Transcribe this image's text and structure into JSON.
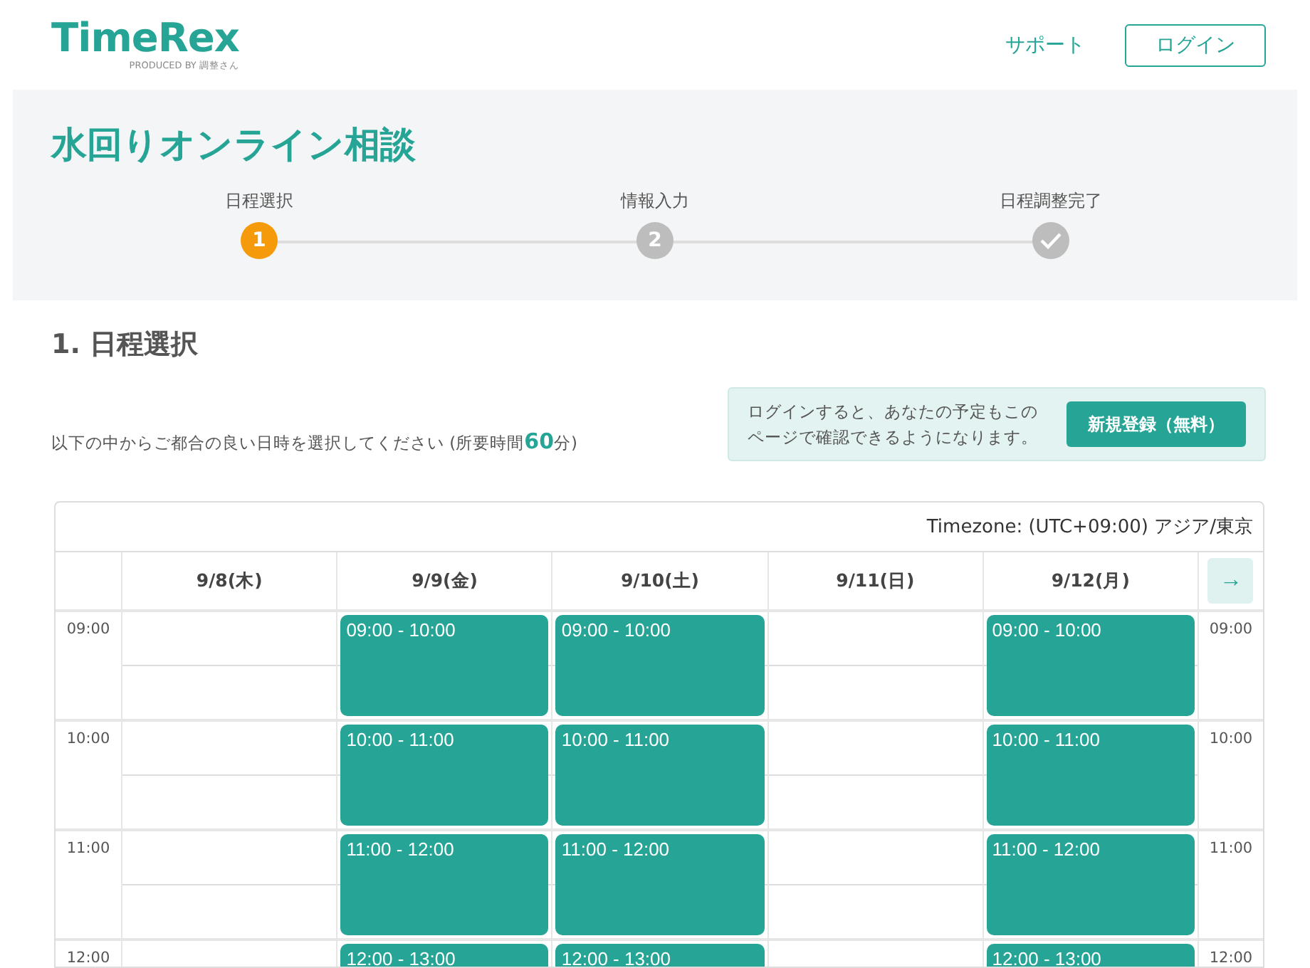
{
  "header": {
    "logo": "TimeRex",
    "logo_tagline": "PRODUCED BY 調整さん",
    "links": [
      {
        "label": "サポート",
        "kind": "link"
      },
      {
        "label": "ログイン",
        "kind": "button"
      }
    ]
  },
  "hero": {
    "title": "水回りオンライン相談",
    "steps": [
      {
        "label": "日程選択",
        "kind": "number",
        "marker": "1",
        "selected": true
      },
      {
        "label": "情報入力",
        "kind": "number",
        "marker": "2",
        "selected": false
      },
      {
        "label": "日程調整完了",
        "kind": "check",
        "selected": false
      }
    ]
  },
  "section": {
    "heading": "1. 日程選択",
    "instruction": "以下の中からご都合の良い日時を選択してください (所要時間**60**分)",
    "notice": {
      "text": "ログインすると、あなたの予定もこのページで確認できるようになります。",
      "button": "新規登録（無料）"
    }
  },
  "calendar": {
    "timezone": "Timezone: (UTC+09:00) アジア/東京",
    "next_button": "→",
    "days": [
      "9/8(木)",
      "9/9(金)",
      "9/10(土)",
      "9/11(日)",
      "9/12(月)"
    ],
    "rows": [
      {
        "time": "09:00",
        "time_right": "09:00",
        "cells": [
          {
            "available": false
          },
          {
            "available": true,
            "label": "09:00 - 10:00"
          },
          {
            "available": true,
            "label": "09:00 - 10:00"
          },
          {
            "available": false
          },
          {
            "available": true,
            "label": "09:00 - 10:00"
          }
        ]
      },
      {
        "time": "10:00",
        "time_right": "10:00",
        "cells": [
          {
            "available": false
          },
          {
            "available": true,
            "label": "10:00 - 11:00"
          },
          {
            "available": true,
            "label": "10:00 - 11:00"
          },
          {
            "available": false
          },
          {
            "available": true,
            "label": "10:00 - 11:00"
          }
        ]
      },
      {
        "time": "11:00",
        "time_right": "11:00",
        "cells": [
          {
            "available": false
          },
          {
            "available": true,
            "label": "11:00 - 12:00"
          },
          {
            "available": true,
            "label": "11:00 - 12:00"
          },
          {
            "available": false
          },
          {
            "available": true,
            "label": "11:00 - 12:00"
          }
        ]
      },
      {
        "time": "12:00",
        "time_right": "12:00",
        "cells": [
          {
            "available": false
          },
          {
            "available": true,
            "label": "12:00 - 13:00"
          },
          {
            "available": true,
            "label": "12:00 - 13:00"
          },
          {
            "available": false
          },
          {
            "available": true,
            "label": "12:00 - 13:00"
          }
        ]
      }
    ]
  }
}
